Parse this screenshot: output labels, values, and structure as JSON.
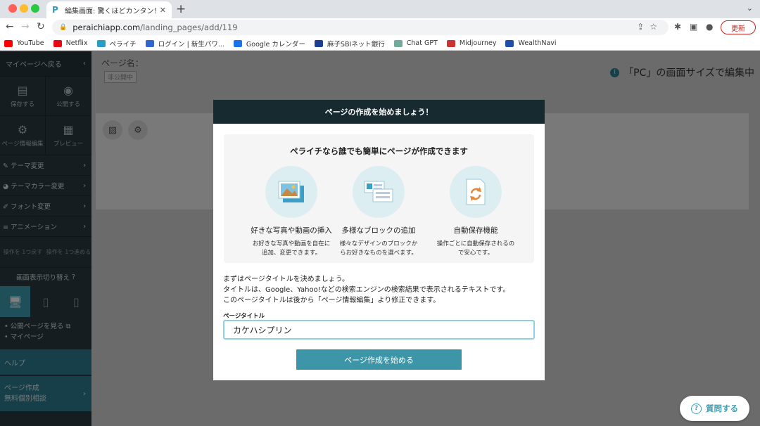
{
  "browser": {
    "tab_title": "編集画面: 驚くほどカンタン！無料",
    "url_host": "peraichiapp.com",
    "url_path": "/landing_pages/add/119",
    "update_label": "更新"
  },
  "bookmarks": [
    {
      "label": "YouTube",
      "icon": "youtube-icon",
      "color": "#ff0000"
    },
    {
      "label": "Netflix",
      "icon": "netflix-icon",
      "color": "#e50914"
    },
    {
      "label": "ペライチ",
      "icon": "peraichi-icon",
      "color": "#2a9cc8"
    },
    {
      "label": "ログイン | 新生パワ...",
      "icon": "login-icon",
      "color": "#3366cc"
    },
    {
      "label": "Google カレンダー",
      "icon": "calendar-icon",
      "color": "#1a73e8"
    },
    {
      "label": "麻子SBIネット銀行",
      "icon": "bank-icon",
      "color": "#1c3f94"
    },
    {
      "label": "Chat GPT",
      "icon": "chatgpt-icon",
      "color": "#74aa9c"
    },
    {
      "label": "Midjourney",
      "icon": "midjourney-icon",
      "color": "#cc3333"
    },
    {
      "label": "WealthNavi",
      "icon": "wealthnavi-icon",
      "color": "#1f4fa8"
    }
  ],
  "sidebar": {
    "back_label": "マイページへ戻る",
    "save_label": "保存する",
    "publish_label": "公開する",
    "page_info_label": "ページ情報編集",
    "preview_label": "プレビュー",
    "theme_label": "テーマ変更",
    "theme_color_label": "テーマカラー変更",
    "font_label": "フォント変更",
    "animation_label": "アニメーション",
    "undo_label": "操作を 1つ戻す",
    "redo_label": "操作を 1つ進める",
    "display_toggle_label": "画面表示切り替え",
    "view_public_label": "公開ページを見る",
    "mypage_label": "マイページ",
    "help_label": "ヘルプ",
    "consult_line1": "ページ作成",
    "consult_line2": "無料個別相談"
  },
  "main": {
    "page_name_label": "ページ名：",
    "unpublished_badge": "非公開中",
    "edit_hint": "「PC」の画面サイズで編集中"
  },
  "modal": {
    "header": "ページの作成を始めましょう！",
    "feature_heading": "ペライチなら誰でも簡単にページが作成できます",
    "features": [
      {
        "title": "好きな写真や動画の挿入",
        "desc1": "お好きな写真や動画を自在に",
        "desc2": "追加、変更できます。"
      },
      {
        "title": "多様なブロックの追加",
        "desc1": "様々なデザインのブロックか",
        "desc2": "らお好きなものを選べます。"
      },
      {
        "title": "自動保存機能",
        "desc1": "操作ごとに自動保存されるの",
        "desc2": "で安心です。"
      }
    ],
    "intro1": "まずはページタイトルを決めましょう。",
    "intro2": "タイトルは、Google、Yahoo!などの検索エンジンの検索結果で表示されるテキストです。",
    "intro3": "このページタイトルは後から「ページ情報編集」より修正できます。",
    "field_label": "ページタイトル",
    "title_value": "カケハシプリン",
    "start_button": "ページ作成を始める"
  },
  "question_button": "質問する"
}
